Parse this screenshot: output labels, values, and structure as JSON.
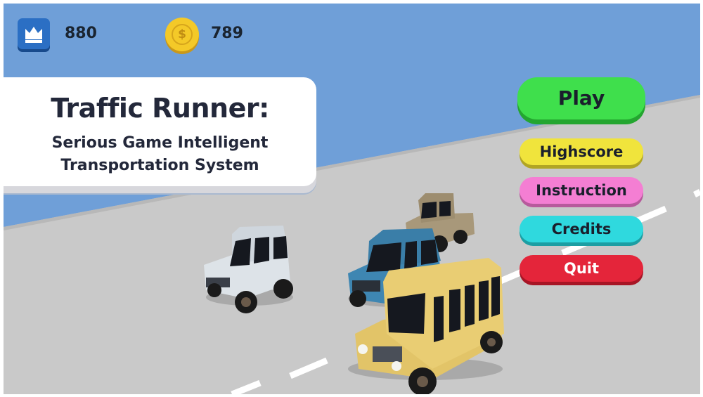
{
  "hud": {
    "highscore_value": "880",
    "coins_value": "789",
    "crown_icon": "crown-icon",
    "coin_icon": "dollar-coin-icon",
    "coin_symbol": "$"
  },
  "title": {
    "main": "Traffic Runner:",
    "subtitle_line1": "Serious Game Intelligent",
    "subtitle_line2": "Transportation System"
  },
  "menu": {
    "play": "Play",
    "highscore": "Highscore",
    "instruction": "Instruction",
    "credits": "Credits",
    "quit": "Quit"
  },
  "colors": {
    "sky": "#6f9fd8",
    "road": "#c9c9c9",
    "play": "#3fdf4c",
    "highscore": "#f0e43c",
    "instruction": "#f47ed3",
    "credits": "#2fd9de",
    "quit": "#e4253a"
  },
  "vehicles": [
    {
      "type": "jeep",
      "color": "white"
    },
    {
      "type": "pickup-truck",
      "color": "khaki"
    },
    {
      "type": "jeep",
      "color": "blue"
    },
    {
      "type": "bus",
      "color": "yellow"
    }
  ]
}
